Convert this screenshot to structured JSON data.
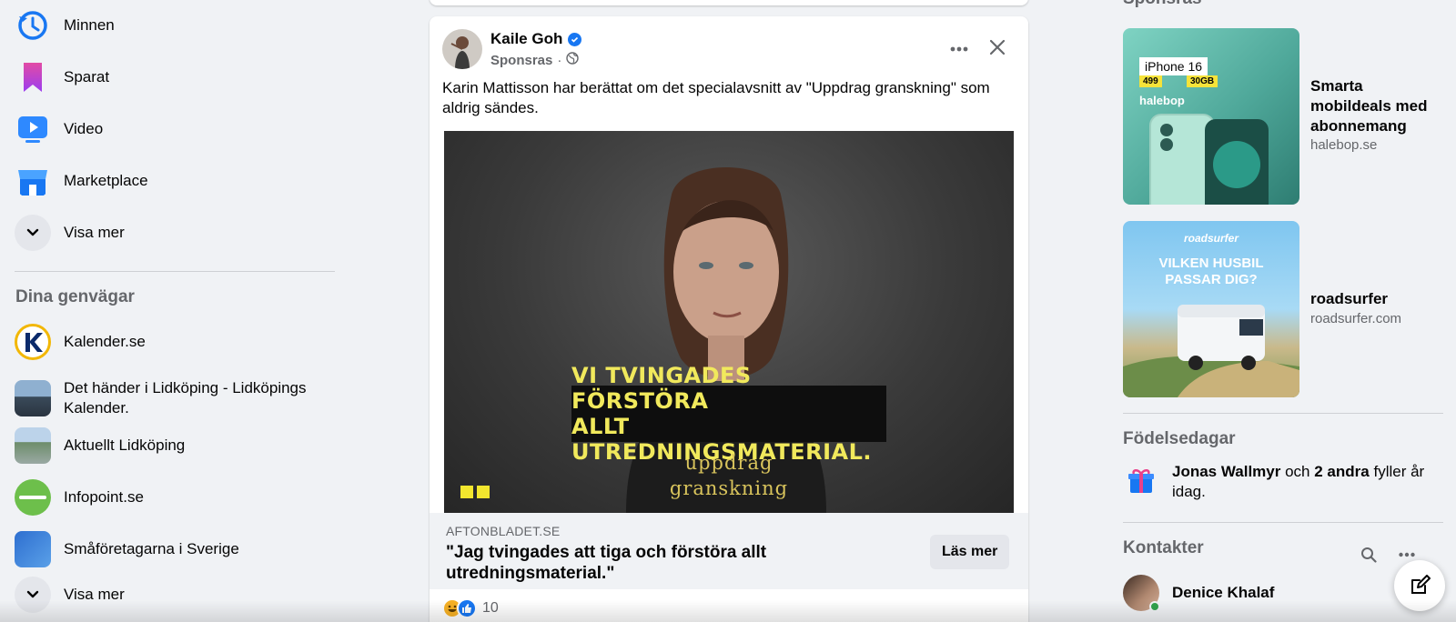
{
  "sidebar": {
    "items": [
      {
        "label": "Minnen",
        "icon": "clock-icon"
      },
      {
        "label": "Sparat",
        "icon": "bookmark-icon"
      },
      {
        "label": "Video",
        "icon": "video-icon"
      },
      {
        "label": "Marketplace",
        "icon": "shop-icon"
      },
      {
        "label": "Visa mer",
        "icon": "chevron-down-icon"
      }
    ],
    "shortcuts_title": "Dina genvägar",
    "shortcuts": [
      {
        "label": "Kalender.se"
      },
      {
        "label": "Det händer i Lidköping - Lidköpings Kalender."
      },
      {
        "label": "Aktuellt Lidköping"
      },
      {
        "label": "Infopoint.se"
      },
      {
        "label": "Småföretagarna i Sverige"
      },
      {
        "label": "Visa mer"
      }
    ]
  },
  "post": {
    "author": "Kaile Goh",
    "sponsored": "Sponsras",
    "meta_sep": "·",
    "text": "Karin Mattisson har berättat om det specialavsnitt av \"Uppdrag granskning\" som aldrig sändes.",
    "image": {
      "caption_line1": "VI TVINGADES FÖRSTÖRA",
      "caption_line2": "ALLT UTREDNINGSMATERIAL.",
      "brand_line1": "uppdrag",
      "brand_line2": "granskning"
    },
    "link": {
      "domain": "AFTONBLADET.SE",
      "title": "\"Jag tvingades att tiga och förstöra allt utredningsmaterial.\"",
      "button": "Läs mer"
    },
    "reaction_count": "10"
  },
  "right": {
    "sponsored_title": "Sponsras",
    "ads": [
      {
        "title": "Smarta mobildeals med abonnemang",
        "domain": "halebop.se",
        "image_text": {
          "model": "iPhone 16",
          "price": "499",
          "data": "30GB",
          "brand": "halebop"
        }
      },
      {
        "title": "roadsurfer",
        "domain": "roadsurfer.com",
        "image_text": {
          "brand": "roadsurfer",
          "headline1": "VILKEN HUSBIL",
          "headline2": "PASSAR DIG?"
        }
      }
    ],
    "birthdays_title": "Födelsedagar",
    "birthday": {
      "name": "Jonas Wallmyr",
      "and": "och",
      "others": "2 andra",
      "rest": "fyller år idag."
    },
    "contacts_title": "Kontakter",
    "contacts": [
      {
        "name": "Denice Khalaf"
      }
    ]
  },
  "colors": {
    "accent": "#1877f2",
    "online": "#31a24c",
    "caption": "#f1e95c"
  }
}
